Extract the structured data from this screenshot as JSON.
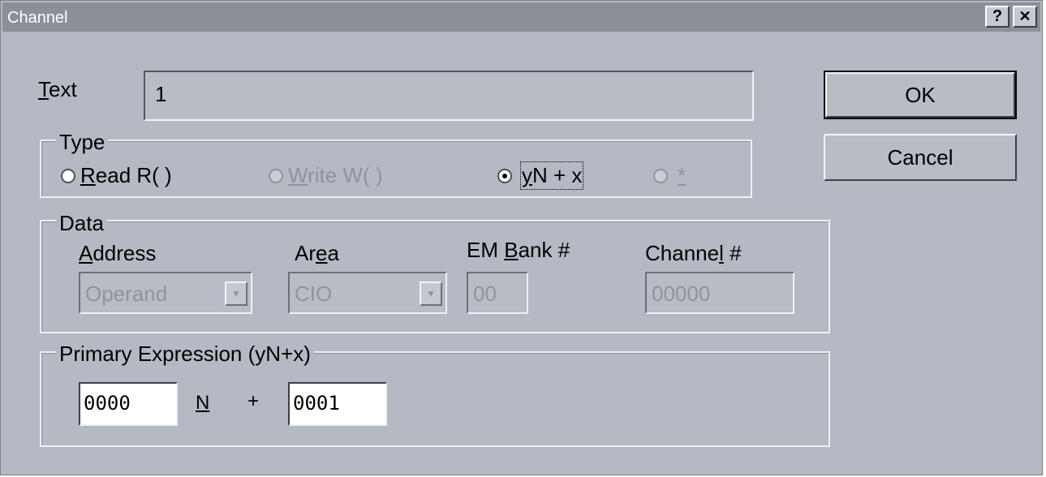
{
  "window": {
    "title": "Channel",
    "help_button": "?",
    "close_button": "✕"
  },
  "text_field": {
    "label": "Text",
    "label_mnemonic": "T",
    "label_rest": "ext",
    "value": "1"
  },
  "type_group": {
    "title": "Type",
    "options": [
      {
        "mnemonic": "R",
        "rest": "ead R( )",
        "enabled": true,
        "selected": false
      },
      {
        "mnemonic": "W",
        "rest": "rite W( )",
        "enabled": false,
        "selected": false
      },
      {
        "mnemonic": "y",
        "rest": "N + x",
        "enabled": true,
        "selected": true
      },
      {
        "mnemonic": "*",
        "rest": "",
        "enabled": false,
        "selected": false
      }
    ]
  },
  "data_group": {
    "title": "Data",
    "address": {
      "mnemonic": "A",
      "rest": "ddress",
      "value": "Operand"
    },
    "area": {
      "pre": "Ar",
      "mnemonic": "e",
      "rest": "a",
      "value": "CIO"
    },
    "em_bank": {
      "pre": "EM ",
      "mnemonic": "B",
      "rest": "ank #",
      "value": "00"
    },
    "channel": {
      "pre": "Channe",
      "mnemonic": "l",
      "rest": " #",
      "value": "00000"
    }
  },
  "primary_group": {
    "title": "Primary Expression (yN+x)",
    "y_value": "0000",
    "n_label": "N",
    "plus": "+",
    "x_value": "0001"
  },
  "buttons": {
    "ok": "OK",
    "cancel": "Cancel"
  }
}
